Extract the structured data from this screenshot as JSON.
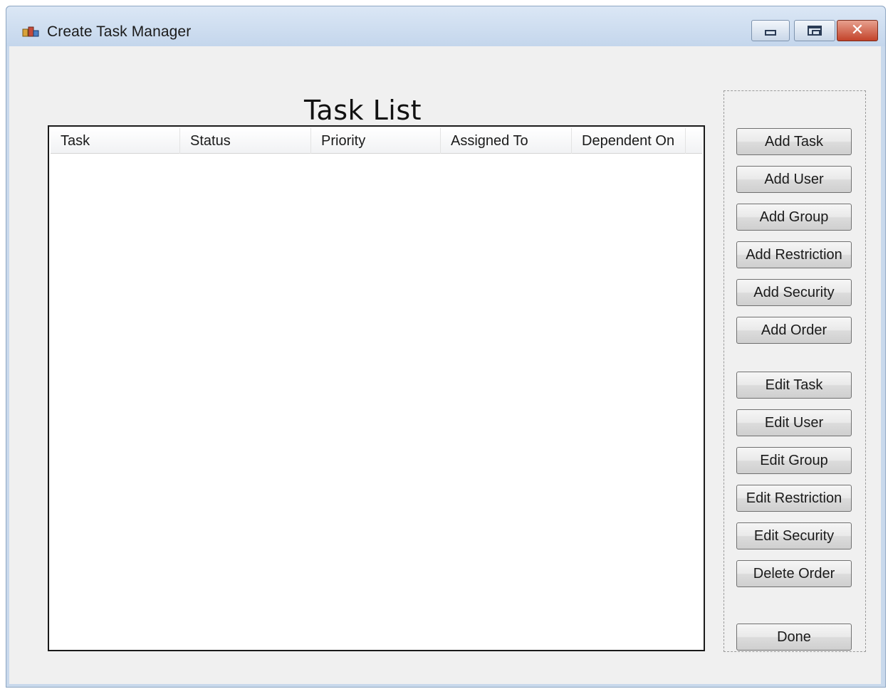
{
  "window": {
    "title": "Create Task Manager",
    "app_icon": "app-icon",
    "controls": [
      "minimize-icon",
      "maximize-icon",
      "close-icon"
    ]
  },
  "heading": "Task List",
  "task_list": {
    "columns": [
      "Task",
      "Status",
      "Priority",
      "Assigned To",
      "Dependent On"
    ],
    "rows": []
  },
  "buttons": {
    "add_task": "Add Task",
    "add_user": "Add User",
    "add_group": "Add Group",
    "add_restriction": "Add Restriction",
    "add_security": "Add Security",
    "add_order": "Add Order",
    "edit_task": "Edit Task",
    "edit_user": "Edit User",
    "edit_group": "Edit Group",
    "edit_restriction": "Edit Restriction",
    "edit_security": "Edit Security",
    "delete_order": "Delete Order",
    "done": "Done"
  },
  "colors": {
    "titlebar": "#c4d6ec",
    "client_background": "#f0f0f0",
    "close_button": "#c3432a"
  }
}
